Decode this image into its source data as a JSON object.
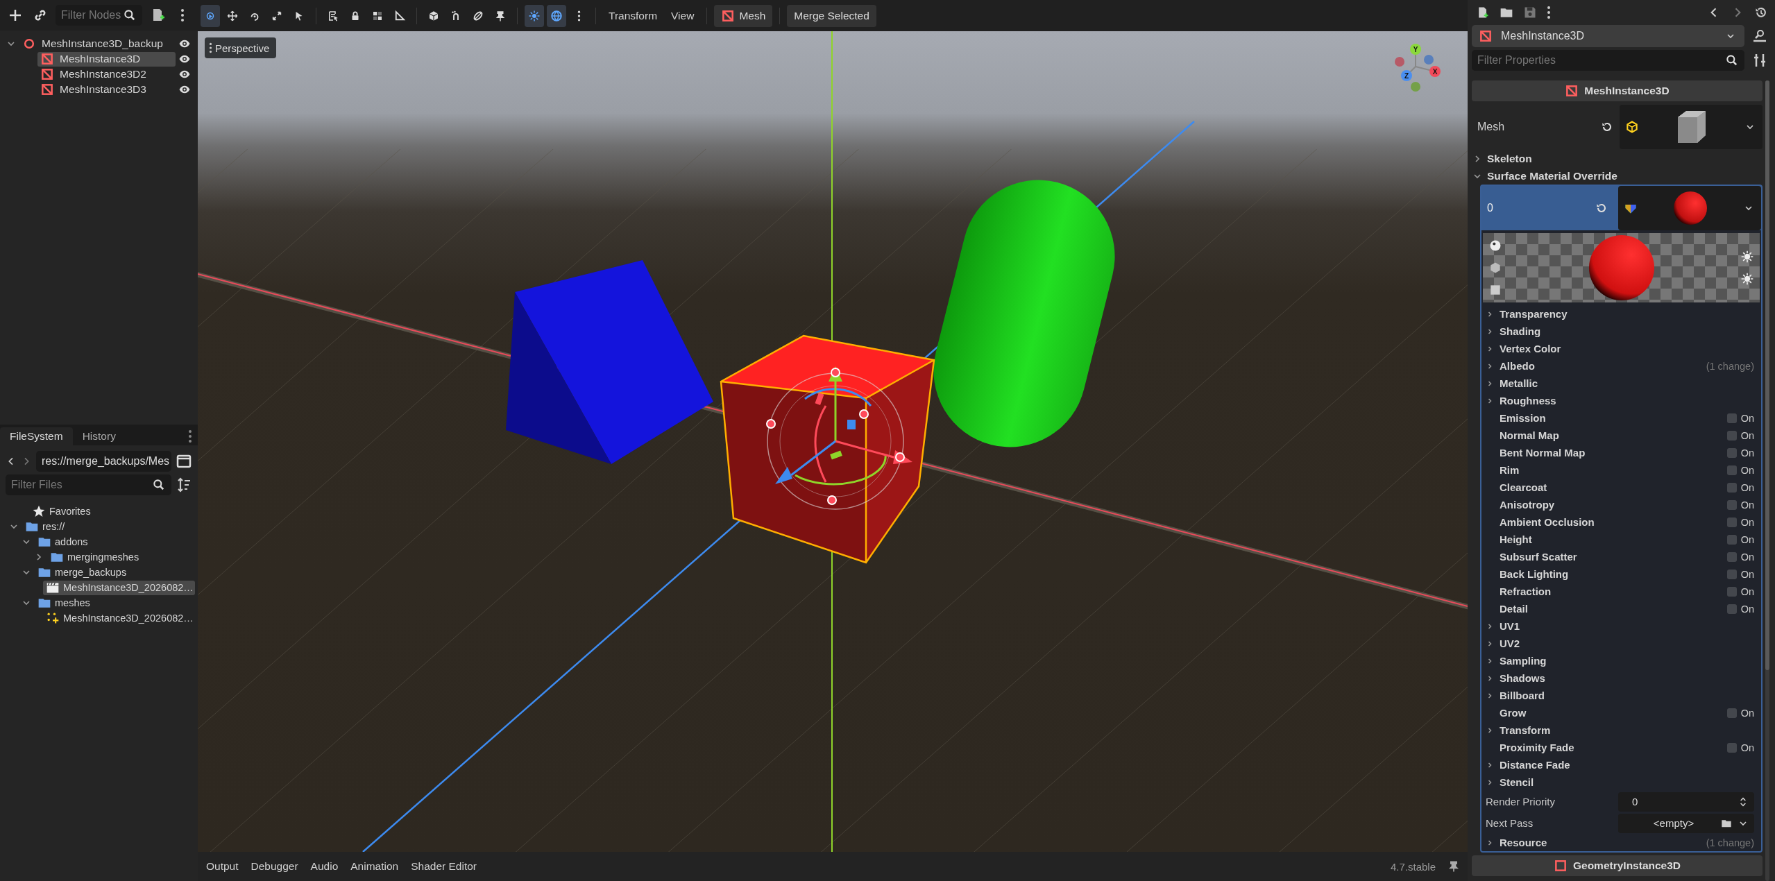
{
  "scene_dock": {
    "filter_placeholder": "Filter Nodes",
    "tree": [
      {
        "label": "MeshInstance3D_backup",
        "kind": "root",
        "selected": false,
        "visible": true,
        "expanded": true,
        "children": [
          {
            "label": "MeshInstance3D",
            "kind": "mesh",
            "selected": true,
            "visible": true
          },
          {
            "label": "MeshInstance3D2",
            "kind": "mesh",
            "selected": false,
            "visible": true
          },
          {
            "label": "MeshInstance3D3",
            "kind": "mesh",
            "selected": false,
            "visible": true
          }
        ]
      }
    ]
  },
  "filesystem": {
    "tabs": [
      {
        "label": "FileSystem",
        "selected": true
      },
      {
        "label": "History",
        "selected": false
      }
    ],
    "path": "res://merge_backups/Mes",
    "filter_placeholder": "Filter Files",
    "favorites": "Favorites",
    "tree": [
      {
        "label": "res://",
        "kind": "folder",
        "expanded": true,
        "selected": false,
        "children": [
          {
            "label": "addons",
            "kind": "folder",
            "expanded": true,
            "selected": false,
            "children": [
              {
                "label": "mergingmeshes",
                "kind": "folder",
                "expanded": false,
                "selected": false
              }
            ]
          },
          {
            "label": "merge_backups",
            "kind": "folder",
            "expanded": true,
            "selected": false,
            "children": [
              {
                "label": "MeshInstance3D_2026082…",
                "kind": "scene",
                "selected": true
              }
            ]
          },
          {
            "label": "meshes",
            "kind": "folder",
            "expanded": true,
            "selected": false,
            "children": [
              {
                "label": "MeshInstance3D_2026082…",
                "kind": "mesh",
                "selected": false
              }
            ]
          }
        ]
      }
    ]
  },
  "viewport_toolbar": {
    "tools": [
      {
        "selected": true
      },
      {
        "selected": false
      },
      {
        "selected": false
      },
      {
        "selected": false
      },
      {
        "selected": false
      },
      {
        "selected": false
      },
      {
        "selected": false
      },
      {
        "selected": false
      },
      {
        "selected": false
      },
      {
        "selected": false
      },
      {
        "selected": false
      },
      {
        "selected": false
      },
      {
        "selected": false
      },
      {
        "selected": true
      },
      {
        "selected": true
      }
    ],
    "menus": [
      "Transform",
      "View"
    ],
    "mesh_button": "Mesh",
    "merge_button": "Merge Selected"
  },
  "viewport": {
    "view_button": "Perspective",
    "gizmo_axes": [
      "Y",
      "X",
      "Z"
    ]
  },
  "bottom_panel": {
    "tabs": [
      "Output",
      "Debugger",
      "Audio",
      "Animation",
      "Shader Editor"
    ],
    "version": "4.7.stable"
  },
  "inspector": {
    "node_name": "MeshInstance3D",
    "filter_placeholder": "Filter Properties",
    "class_header": "MeshInstance3D",
    "mesh_label": "Mesh",
    "sections": [
      {
        "label": "Skeleton",
        "expanded": false
      },
      {
        "label": "Surface Material Override",
        "expanded": true
      }
    ],
    "surface_index": "0",
    "material_props": [
      {
        "kind": "group",
        "label": "Transparency",
        "expanded": false
      },
      {
        "kind": "group",
        "label": "Shading",
        "expanded": false
      },
      {
        "kind": "group",
        "label": "Vertex Color",
        "expanded": false
      },
      {
        "kind": "group",
        "label": "Albedo",
        "expanded": false,
        "note": "(1 change)"
      },
      {
        "kind": "group",
        "label": "Metallic",
        "expanded": false
      },
      {
        "kind": "group",
        "label": "Roughness",
        "expanded": false
      },
      {
        "kind": "toggle",
        "label": "Emission",
        "checked": false,
        "text": "On"
      },
      {
        "kind": "toggle",
        "label": "Normal Map",
        "checked": false,
        "text": "On"
      },
      {
        "kind": "toggle",
        "label": "Bent Normal Map",
        "checked": false,
        "text": "On"
      },
      {
        "kind": "toggle",
        "label": "Rim",
        "checked": false,
        "text": "On"
      },
      {
        "kind": "toggle",
        "label": "Clearcoat",
        "checked": false,
        "text": "On"
      },
      {
        "kind": "toggle",
        "label": "Anisotropy",
        "checked": false,
        "text": "On"
      },
      {
        "kind": "toggle",
        "label": "Ambient Occlusion",
        "checked": false,
        "text": "On"
      },
      {
        "kind": "toggle",
        "label": "Height",
        "checked": false,
        "text": "On"
      },
      {
        "kind": "toggle",
        "label": "Subsurf Scatter",
        "checked": false,
        "text": "On"
      },
      {
        "kind": "toggle",
        "label": "Back Lighting",
        "checked": false,
        "text": "On"
      },
      {
        "kind": "toggle",
        "label": "Refraction",
        "checked": false,
        "text": "On"
      },
      {
        "kind": "toggle",
        "label": "Detail",
        "checked": false,
        "text": "On"
      },
      {
        "kind": "group",
        "label": "UV1",
        "expanded": false
      },
      {
        "kind": "group",
        "label": "UV2",
        "expanded": false
      },
      {
        "kind": "group",
        "label": "Sampling",
        "expanded": false
      },
      {
        "kind": "group",
        "label": "Shadows",
        "expanded": false
      },
      {
        "kind": "group",
        "label": "Billboard",
        "expanded": false
      },
      {
        "kind": "toggle",
        "label": "Grow",
        "checked": false,
        "text": "On"
      },
      {
        "kind": "group",
        "label": "Transform",
        "expanded": false
      },
      {
        "kind": "toggle",
        "label": "Proximity Fade",
        "checked": false,
        "text": "On"
      },
      {
        "kind": "group",
        "label": "Distance Fade",
        "expanded": false
      },
      {
        "kind": "group",
        "label": "Stencil",
        "expanded": false
      },
      {
        "kind": "number",
        "label": "Render Priority",
        "value": "0"
      },
      {
        "kind": "resource",
        "label": "Next Pass",
        "value": "<empty>"
      },
      {
        "kind": "group",
        "label": "Resource",
        "expanded": false,
        "note": "(1 change)"
      }
    ],
    "next_header": "GeometryInstance3D"
  }
}
